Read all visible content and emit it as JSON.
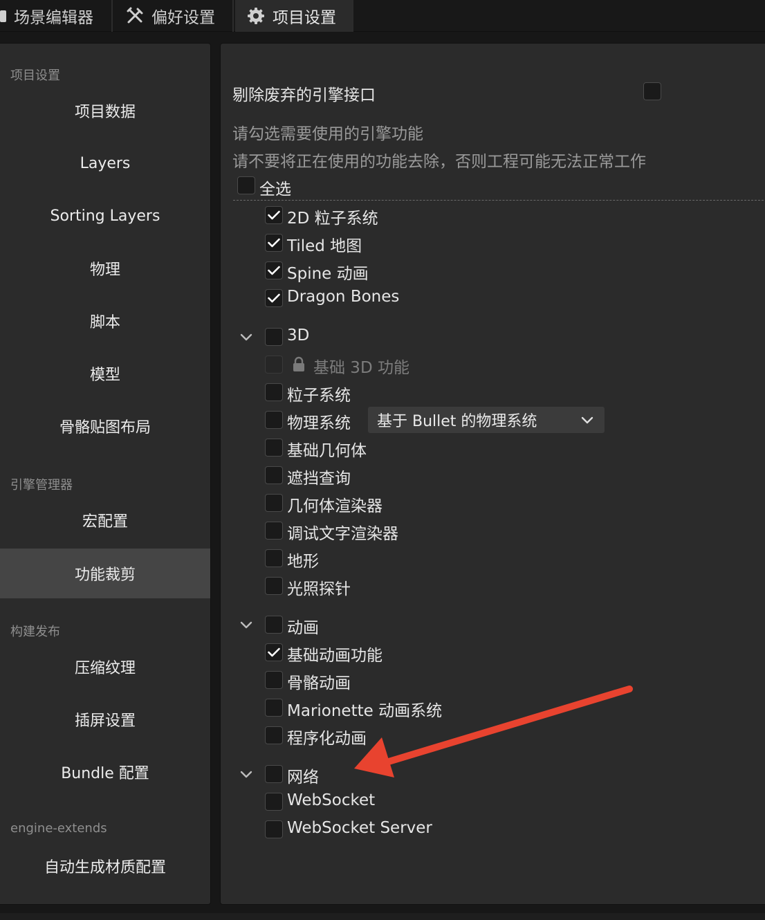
{
  "tabs": [
    {
      "label": "场景编辑器",
      "icon": "scene-icon"
    },
    {
      "label": "偏好设置",
      "icon": "tools-icon"
    },
    {
      "label": "项目设置",
      "icon": "gear-icon"
    }
  ],
  "sidebar": {
    "groups": [
      "项目设置",
      "引擎管理器",
      "构建发布",
      "engine-extends"
    ],
    "items": [
      "项目数据",
      "Layers",
      "Sorting Layers",
      "物理",
      "脚本",
      "模型",
      "骨骼贴图布局",
      "宏配置",
      "功能裁剪",
      "压缩纹理",
      "插屏设置",
      "Bundle 配置",
      "自动生成材质配置"
    ],
    "active": "功能裁剪"
  },
  "main": {
    "remove_deprecated_label": "剔除废弃的引擎接口",
    "hint1": "请勾选需要使用的引擎功能",
    "hint2": "请不要将正在使用的功能去除，否则工程可能无法正常工作",
    "select_all": "全选",
    "items": [
      {
        "label": "2D 粒子系统",
        "checked": true
      },
      {
        "label": "Tiled 地图",
        "checked": true
      },
      {
        "label": "Spine 动画",
        "checked": true
      },
      {
        "label": "Dragon Bones",
        "checked": true
      },
      {
        "label": "3D",
        "checked": false
      },
      {
        "label": "基础 3D 功能",
        "checked": false
      },
      {
        "label": "粒子系统",
        "checked": false
      },
      {
        "label": "物理系统",
        "checked": false
      },
      {
        "label": "基础几何体",
        "checked": false
      },
      {
        "label": "遮挡查询",
        "checked": false
      },
      {
        "label": "几何体渲染器",
        "checked": false
      },
      {
        "label": "调试文字渲染器",
        "checked": false
      },
      {
        "label": "地形",
        "checked": false
      },
      {
        "label": "光照探针",
        "checked": false
      },
      {
        "label": "动画",
        "checked": false
      },
      {
        "label": "基础动画功能",
        "checked": true
      },
      {
        "label": "骨骼动画",
        "checked": false
      },
      {
        "label": "Marionette 动画系统",
        "checked": false
      },
      {
        "label": "程序化动画",
        "checked": false
      },
      {
        "label": "网络",
        "checked": false
      },
      {
        "label": "WebSocket",
        "checked": false
      },
      {
        "label": "WebSocket Server",
        "checked": false
      }
    ],
    "physics_select": "基于 Bullet 的物理系统"
  },
  "colors": {
    "accent_arrow": "#e8432f",
    "active_item": "#454545"
  }
}
